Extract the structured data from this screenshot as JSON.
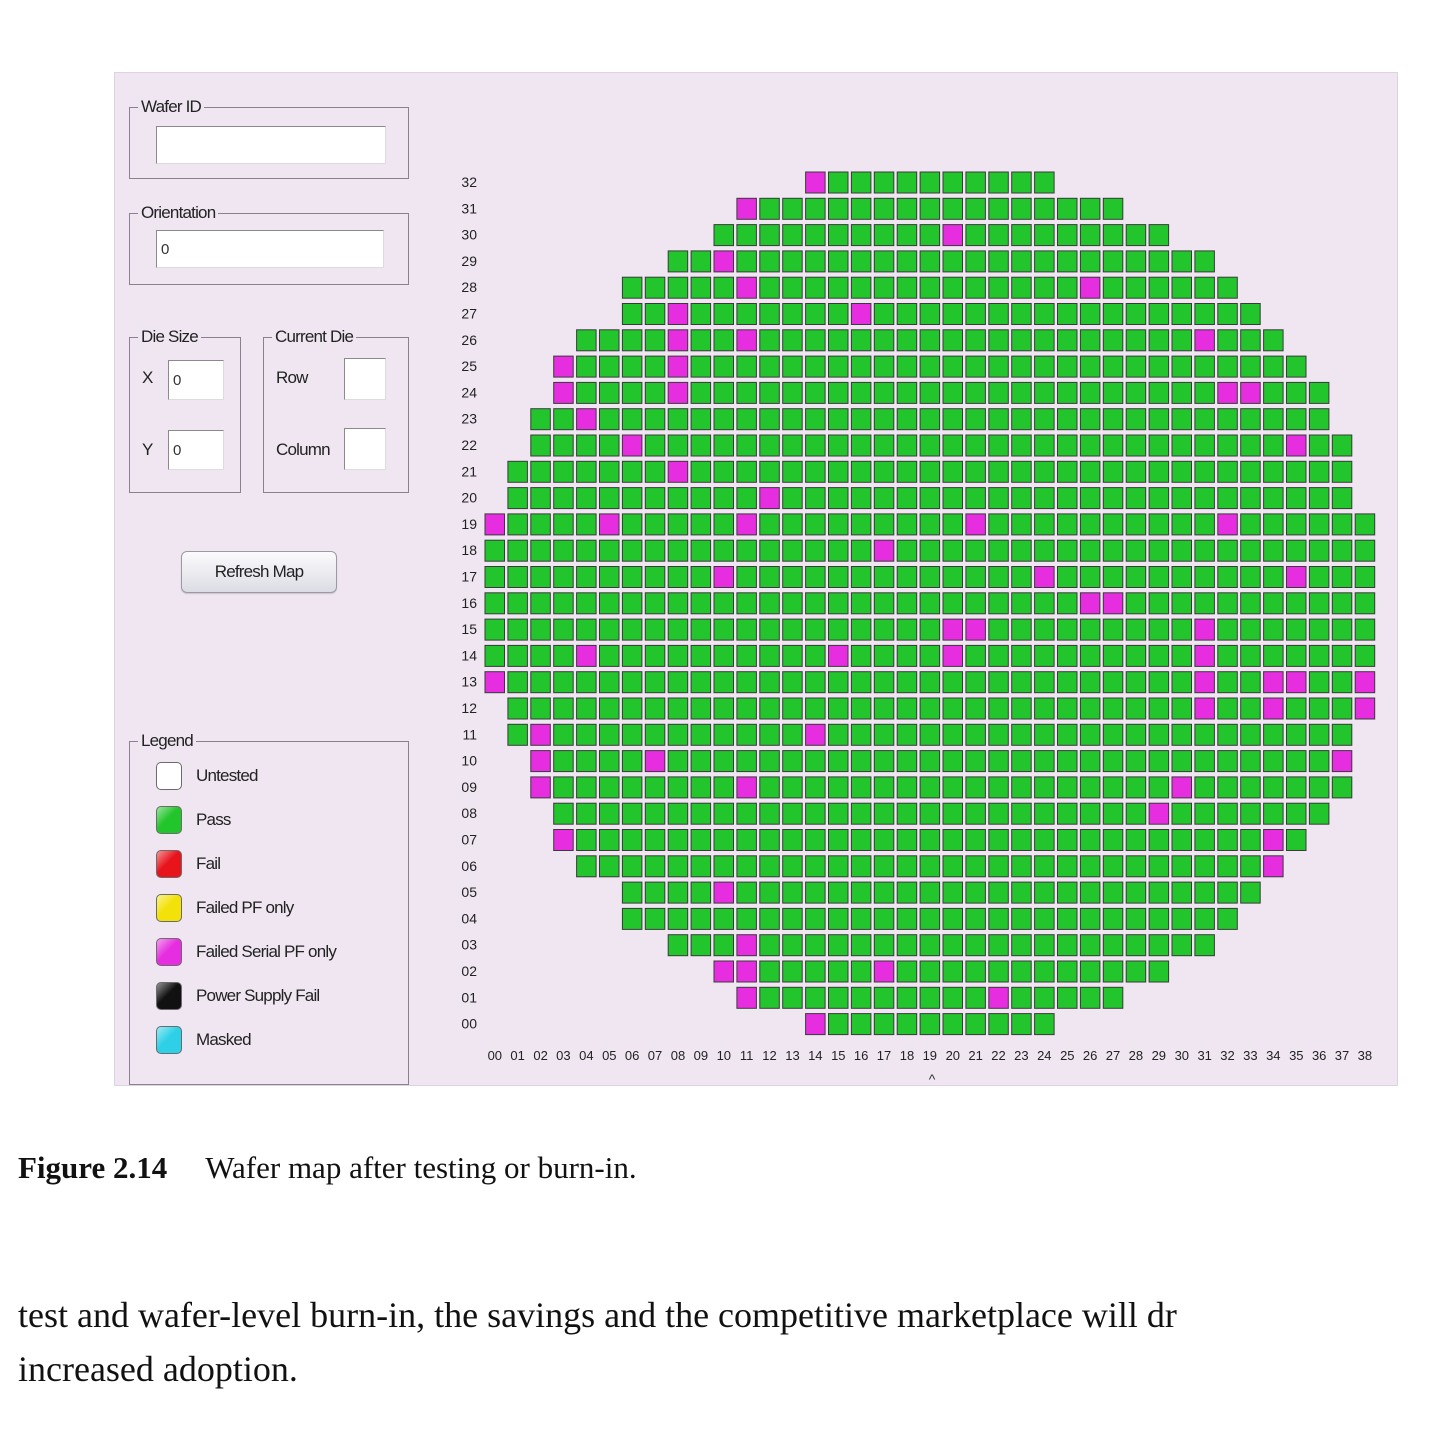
{
  "app": {
    "wafer_id": {
      "label": "Wafer ID",
      "value": ""
    },
    "orientation": {
      "label": "Orientation",
      "value": "0"
    },
    "die_size": {
      "label": "Die Size",
      "x_label": "X",
      "x_value": "0",
      "y_label": "Y",
      "y_value": "0"
    },
    "current_die": {
      "label": "Current Die",
      "row_label": "Row",
      "row_value": "",
      "column_label": "Column",
      "column_value": ""
    },
    "refresh_button": "Refresh Map",
    "legend": {
      "title": "Legend",
      "items": [
        {
          "label": "Untested",
          "color": "#ffffff"
        },
        {
          "label": "Pass",
          "color": "#22c52b"
        },
        {
          "label": "Fail",
          "color": "#e8141c"
        },
        {
          "label": "Failed PF only",
          "color": "#f2e20a"
        },
        {
          "label": "Failed Serial PF only",
          "color": "#e62ee0"
        },
        {
          "label": "Power Supply Fail",
          "color": "#111111"
        },
        {
          "label": "Masked",
          "color": "#2ed0e8"
        }
      ]
    }
  },
  "wafer_map": {
    "columns": 39,
    "rows": 33,
    "pass_color": "#22c52b",
    "fail_serial_color": "#e62ee0",
    "x_axis_marker": "^",
    "row_column_ranges": {
      "32": [
        14,
        24
      ],
      "31": [
        11,
        27
      ],
      "30": [
        10,
        29
      ],
      "29": [
        8,
        31
      ],
      "28": [
        6,
        32
      ],
      "27": [
        6,
        33
      ],
      "26": [
        4,
        34
      ],
      "25": [
        3,
        35
      ],
      "24": [
        3,
        36
      ],
      "23": [
        2,
        36
      ],
      "22": [
        2,
        37
      ],
      "21": [
        1,
        37
      ],
      "20": [
        1,
        37
      ],
      "19": [
        0,
        38
      ],
      "18": [
        0,
        38
      ],
      "17": [
        0,
        38
      ],
      "16": [
        0,
        38
      ],
      "15": [
        0,
        38
      ],
      "14": [
        0,
        38
      ],
      "13": [
        0,
        38
      ],
      "12": [
        1,
        38
      ],
      "11": [
        1,
        37
      ],
      "10": [
        2,
        37
      ],
      "09": [
        2,
        37
      ],
      "08": [
        3,
        36
      ],
      "07": [
        3,
        35
      ],
      "06": [
        4,
        34
      ],
      "05": [
        6,
        33
      ],
      "04": [
        6,
        32
      ],
      "03": [
        8,
        31
      ],
      "02": [
        10,
        29
      ],
      "01": [
        11,
        27
      ],
      "00": [
        14,
        24
      ]
    },
    "failed_serial_pf_dies": [
      [
        32,
        14
      ],
      [
        31,
        11
      ],
      [
        30,
        20
      ],
      [
        29,
        10
      ],
      [
        28,
        11
      ],
      [
        28,
        26
      ],
      [
        27,
        8
      ],
      [
        27,
        16
      ],
      [
        26,
        8
      ],
      [
        26,
        11
      ],
      [
        26,
        31
      ],
      [
        25,
        3
      ],
      [
        25,
        8
      ],
      [
        24,
        3
      ],
      [
        24,
        8
      ],
      [
        24,
        32
      ],
      [
        24,
        33
      ],
      [
        23,
        4
      ],
      [
        22,
        6
      ],
      [
        22,
        35
      ],
      [
        21,
        8
      ],
      [
        20,
        12
      ],
      [
        19,
        0
      ],
      [
        19,
        5
      ],
      [
        19,
        11
      ],
      [
        19,
        21
      ],
      [
        19,
        32
      ],
      [
        18,
        17
      ],
      [
        17,
        10
      ],
      [
        17,
        24
      ],
      [
        17,
        35
      ],
      [
        16,
        26
      ],
      [
        16,
        27
      ],
      [
        15,
        20
      ],
      [
        15,
        21
      ],
      [
        15,
        31
      ],
      [
        14,
        4
      ],
      [
        14,
        15
      ],
      [
        14,
        20
      ],
      [
        14,
        31
      ],
      [
        13,
        0
      ],
      [
        13,
        31
      ],
      [
        13,
        34
      ],
      [
        13,
        35
      ],
      [
        13,
        38
      ],
      [
        12,
        31
      ],
      [
        12,
        34
      ],
      [
        12,
        38
      ],
      [
        11,
        2
      ],
      [
        11,
        14
      ],
      [
        10,
        2
      ],
      [
        10,
        7
      ],
      [
        10,
        37
      ],
      [
        9,
        2
      ],
      [
        9,
        11
      ],
      [
        9,
        30
      ],
      [
        8,
        29
      ],
      [
        7,
        3
      ],
      [
        7,
        34
      ],
      [
        6,
        34
      ],
      [
        5,
        10
      ],
      [
        3,
        11
      ],
      [
        2,
        10
      ],
      [
        2,
        11
      ],
      [
        2,
        17
      ],
      [
        1,
        11
      ],
      [
        1,
        22
      ],
      [
        0,
        14
      ]
    ]
  },
  "caption": {
    "figure_number": "Figure 2.14",
    "text": "Wafer map after testing or burn-in."
  },
  "body_text": {
    "line1": "test and wafer-level burn-in, the savings and the competitive marketplace will dr",
    "line2": "increased adoption."
  }
}
